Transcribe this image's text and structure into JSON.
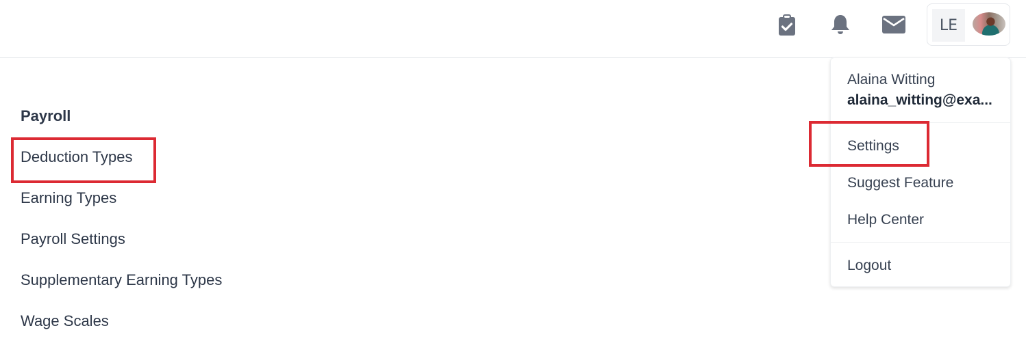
{
  "header": {
    "icons": [
      {
        "name": "clipboard-check-icon"
      },
      {
        "name": "bell-icon"
      },
      {
        "name": "envelope-icon"
      }
    ],
    "user": {
      "initials": "LE",
      "avatar": "user-avatar-photo"
    }
  },
  "user_menu": {
    "name": "Alaina Witting",
    "email": "alaina_witting@exa...",
    "items": [
      {
        "label": "Settings"
      },
      {
        "label": "Suggest Feature"
      },
      {
        "label": "Help Center"
      },
      {
        "label": "Logout"
      }
    ]
  },
  "sidebar": {
    "section_title": "Payroll",
    "items": [
      {
        "label": "Deduction Types"
      },
      {
        "label": "Earning Types"
      },
      {
        "label": "Payroll Settings"
      },
      {
        "label": "Supplementary Earning Types"
      },
      {
        "label": "Wage Scales"
      }
    ]
  },
  "annotations": {
    "highlight_color": "#dc2a33",
    "highlighted": [
      "Deduction Types",
      "Settings"
    ]
  }
}
